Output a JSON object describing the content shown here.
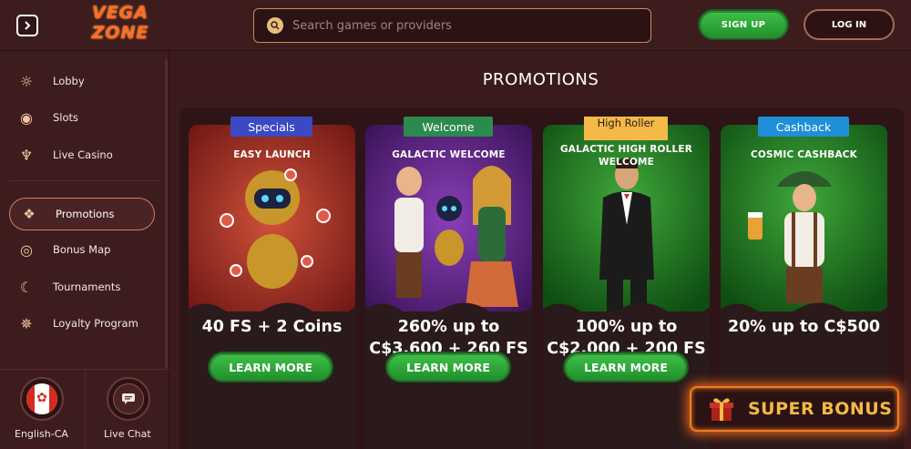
{
  "header": {
    "logo_line1": "VEGA",
    "logo_line2": "ZONE",
    "search_placeholder": "Search games or providers",
    "signup_label": "SIGN UP",
    "login_label": "LOG IN"
  },
  "sidebar": {
    "items": [
      {
        "label": "Lobby",
        "icon": "lobby-icon"
      },
      {
        "label": "Slots",
        "icon": "slots-icon"
      },
      {
        "label": "Live Casino",
        "icon": "live-casino-icon"
      },
      {
        "label": "Promotions",
        "icon": "promotions-icon",
        "active": true
      },
      {
        "label": "Bonus Map",
        "icon": "bonus-map-icon"
      },
      {
        "label": "Tournaments",
        "icon": "tournaments-icon"
      },
      {
        "label": "Loyalty Program",
        "icon": "loyalty-icon"
      }
    ],
    "language_label": "English-CA",
    "chat_label": "Live Chat"
  },
  "main": {
    "title": "PROMOTIONS",
    "cards": [
      {
        "badge": "Specials",
        "badge_color": "#3b49c4",
        "subtitle": "EASY LAUNCH",
        "offer": "40 FS + 2 Coins",
        "button": "LEARN MORE"
      },
      {
        "badge": "Welcome",
        "badge_color": "#2d8a4e",
        "subtitle": "GALACTIC WELCOME",
        "offer": "260% up to C$3,600 + 260 FS",
        "button": "LEARN MORE"
      },
      {
        "badge": "High Roller",
        "badge_color": "#f5b947",
        "subtitle": "GALACTIC HIGH ROLLER WELCOME",
        "offer": "100% up to C$2,000 + 200 FS",
        "button": "LEARN MORE"
      },
      {
        "badge": "Cashback",
        "badge_color": "#1f8fd8",
        "subtitle": "COSMIC CASHBACK",
        "offer": "20% up to C$500",
        "button": "LEARN MORE"
      }
    ]
  },
  "super_bonus_label": "SUPER BONUS",
  "colors": {
    "background": "#3a1a1c",
    "accent_green": "#2d9a36",
    "accent_orange": "#f07c20",
    "gold": "#f5b947"
  }
}
